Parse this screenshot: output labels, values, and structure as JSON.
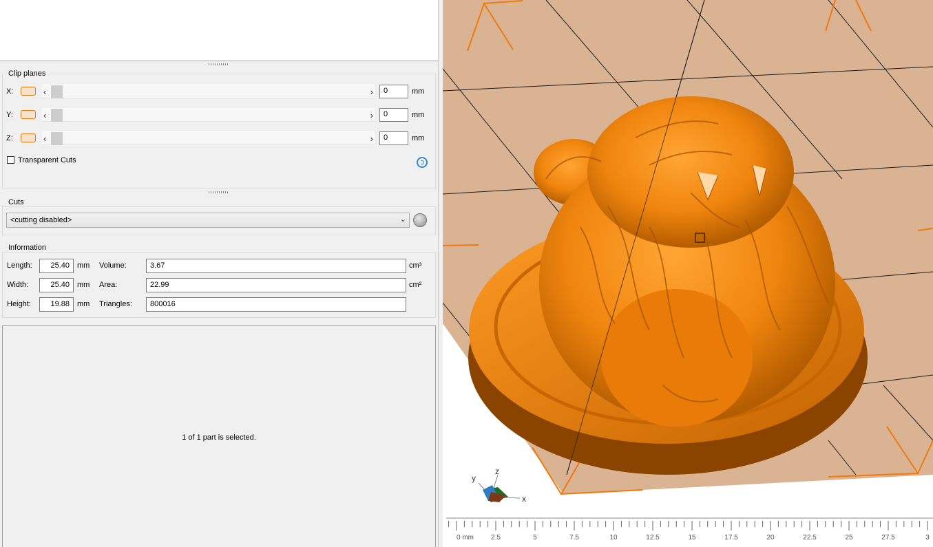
{
  "clip_planes": {
    "title": "Clip planes",
    "axes": [
      {
        "label": "X:",
        "value": "0",
        "unit": "mm"
      },
      {
        "label": "Y:",
        "value": "0",
        "unit": "mm"
      },
      {
        "label": "Z:",
        "value": "0",
        "unit": "mm"
      }
    ],
    "transparent_cuts_label": "Transparent Cuts",
    "transparent_cuts_checked": false,
    "arrow_left": "‹",
    "arrow_right": "›"
  },
  "cuts": {
    "title": "Cuts",
    "selected": "<cutting disabled>",
    "dropdown_arrow": "⌄"
  },
  "information": {
    "title": "Information",
    "length_label": "Length:",
    "length": "25.40",
    "length_unit": "mm",
    "width_label": "Width:",
    "width": "25.40",
    "width_unit": "mm",
    "height_label": "Height:",
    "height": "19.88",
    "height_unit": "mm",
    "volume_label": "Volume:",
    "volume": "3.67",
    "volume_unit": "cm³",
    "area_label": "Area:",
    "area": "22.99",
    "area_unit": "cm²",
    "triangles_label": "Triangles:",
    "triangles": "800016"
  },
  "selection_status": "1 of 1 part is selected.",
  "viewport": {
    "model_color": "#f28a14",
    "plate_color": "#d9b392",
    "axis_labels": {
      "x": "x",
      "y": "y",
      "z": "z"
    },
    "ruler": {
      "first_label": "0 mm",
      "labels": [
        "2.5",
        "5",
        "7.5",
        "10",
        "12.5",
        "15",
        "17.5",
        "20",
        "22.5",
        "25",
        "27.5",
        "3"
      ]
    }
  }
}
